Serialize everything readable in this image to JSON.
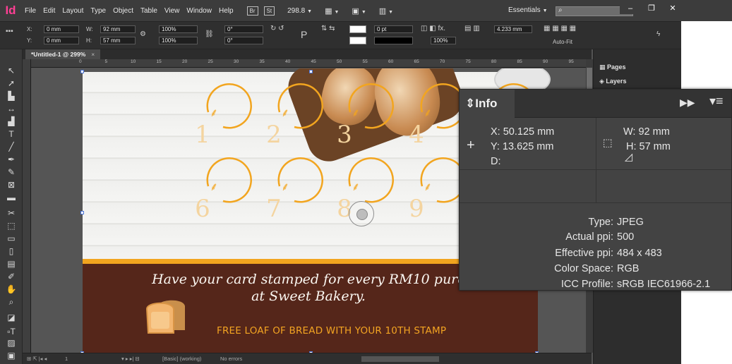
{
  "app": {
    "logo": "Id"
  },
  "menu": {
    "items": [
      "File",
      "Edit",
      "Layout",
      "Type",
      "Object",
      "Table",
      "View",
      "Window",
      "Help"
    ],
    "bridge_label": "Br",
    "stock_label": "St",
    "zoom": "298.8",
    "workspace": "Essentials",
    "search_placeholder": ""
  },
  "window_controls": {
    "minimize": "–",
    "restore": "❐",
    "close": "✕"
  },
  "control_panel": {
    "x_label": "X:",
    "x_value": "0 mm",
    "y_label": "Y:",
    "y_value": "0 mm",
    "w_label": "W:",
    "w_value": "92 mm",
    "h_label": "H:",
    "h_value": "57 mm",
    "scale_x": "100%",
    "scale_y": "100%",
    "rotate": "0°",
    "shear": "0°",
    "stroke_weight": "0 pt",
    "opacity": "100%",
    "gap": "4.233 mm",
    "auto_fit": "Auto-Fit"
  },
  "document": {
    "tab_title": "*Untitled-1 @ 299%",
    "close": "×"
  },
  "ruler_numbers": [
    "0",
    "5",
    "10",
    "15",
    "20",
    "25",
    "30",
    "35",
    "40",
    "45",
    "50",
    "55",
    "60",
    "65",
    "70",
    "75",
    "80",
    "85",
    "90",
    "95",
    "100"
  ],
  "card": {
    "stamps": [
      "1",
      "2",
      "3",
      "4",
      "5",
      "6",
      "7",
      "8",
      "9"
    ],
    "line1": "Have your card stamped for every RM10 purc",
    "line2": "at Sweet Bakery.",
    "tagline": "FREE LOAF OF BREAD WITH YOUR 10TH STAMP",
    "colors": {
      "orange": "#f2a51f",
      "brown": "#55261a",
      "stamp_number": "#f4d49f"
    }
  },
  "dock": {
    "pages": "Pages",
    "layers": "Layers"
  },
  "info": {
    "title": "Info",
    "x": "X: 50.125 mm",
    "y": "Y: 13.625 mm",
    "d": "D:",
    "w": "W: 92 mm",
    "h": "H: 57 mm",
    "type_label": "Type:",
    "type_value": "JPEG",
    "actual_ppi_label": "Actual ppi:",
    "actual_ppi_value": "500",
    "effective_ppi_label": "Effective ppi:",
    "effective_ppi_value": "484 x 483",
    "color_space_label": "Color Space:",
    "color_space_value": "RGB",
    "icc_label": "ICC Profile:",
    "icc_value": "sRGB IEC61966-2.1"
  },
  "status": {
    "page": "1",
    "style": "[Basic] (working)",
    "preflight": "No errors"
  }
}
